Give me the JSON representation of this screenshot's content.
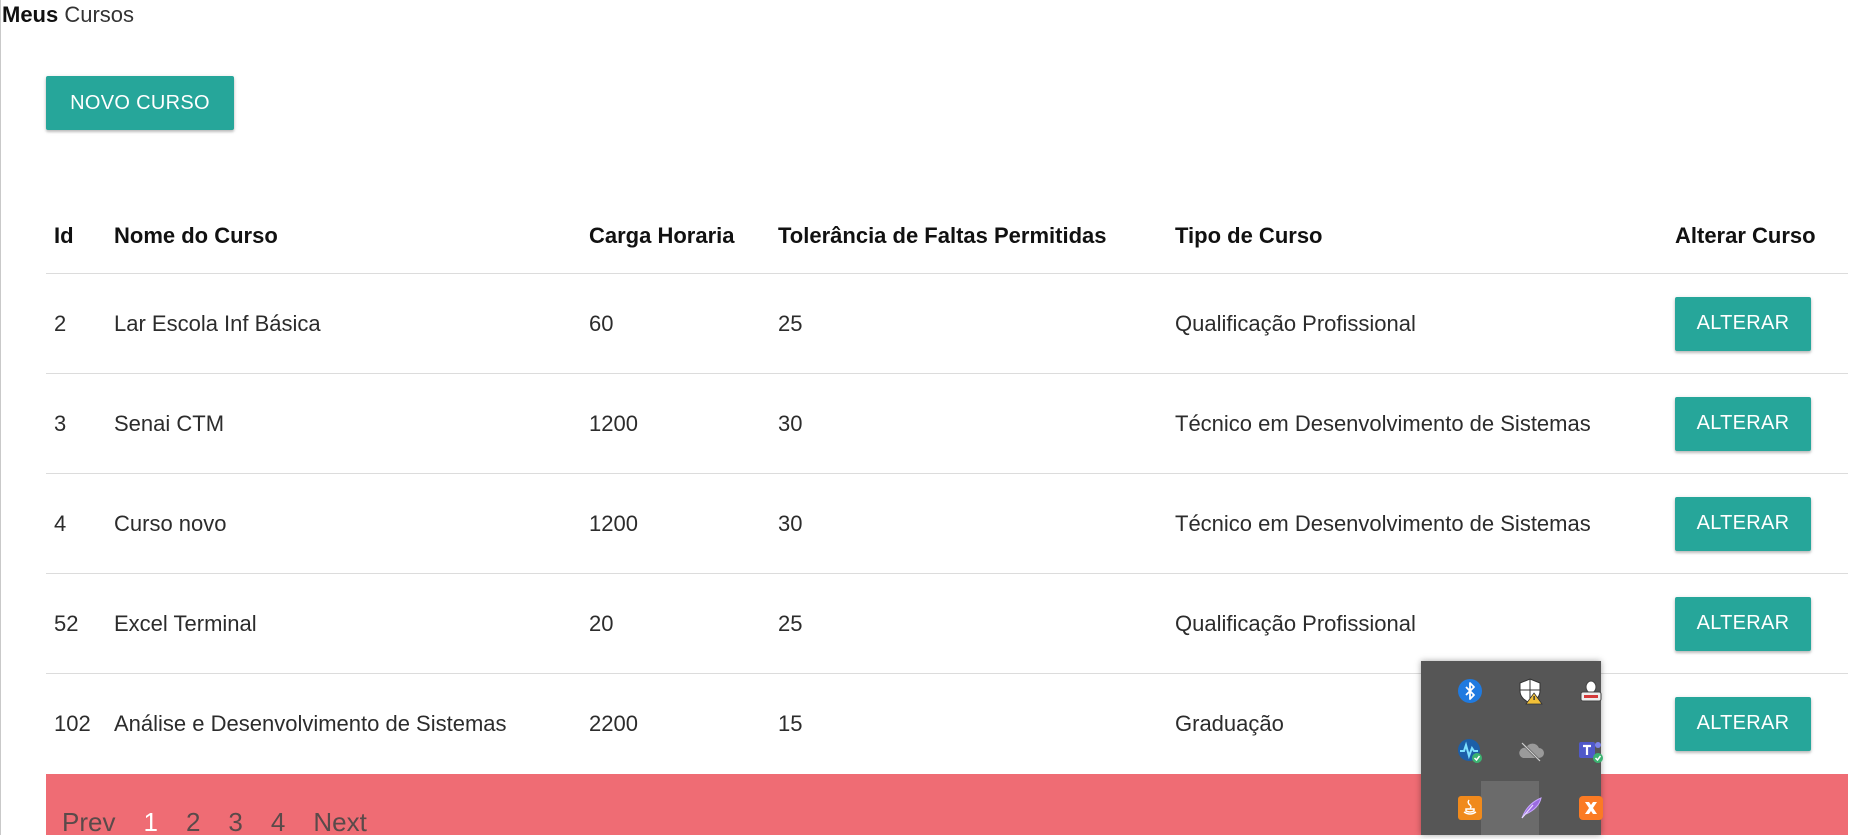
{
  "header": {
    "title_bold": "Meus",
    "title_rest": " Cursos"
  },
  "actions": {
    "new_course_label": "NOVO CURSO"
  },
  "table": {
    "columns": [
      "Id",
      "Nome do Curso",
      "Carga Horaria",
      "Tolerância de Faltas Permitidas",
      "Tipo de Curso",
      "Alterar Curso"
    ],
    "rows": [
      {
        "id": "2",
        "name": "Lar Escola Inf Básica",
        "hours": "60",
        "tolerance": "25",
        "type": "Qualificação Profissional",
        "action": "ALTERAR"
      },
      {
        "id": "3",
        "name": "Senai CTM",
        "hours": "1200",
        "tolerance": "30",
        "type": "Técnico em Desenvolvimento de Sistemas",
        "action": "ALTERAR"
      },
      {
        "id": "4",
        "name": "Curso novo",
        "hours": "1200",
        "tolerance": "30",
        "type": "Técnico em Desenvolvimento de Sistemas",
        "action": "ALTERAR"
      },
      {
        "id": "52",
        "name": "Excel Terminal",
        "hours": "20",
        "tolerance": "25",
        "type": "Qualificação Profissional",
        "action": "ALTERAR"
      },
      {
        "id": "102",
        "name": "Análise e Desenvolvimento de Sistemas",
        "hours": "2200",
        "tolerance": "15",
        "type": "Graduação",
        "action": "ALTERAR"
      }
    ]
  },
  "pagination": {
    "prev": "Prev",
    "pages": [
      "1",
      "2",
      "3",
      "4"
    ],
    "active_page": "1",
    "next": "Next"
  },
  "tray": {
    "icons": [
      "bluetooth-icon",
      "windows-security-icon",
      "pdf-printer-icon",
      "network-monitor-icon",
      "onedrive-icon",
      "teams-icon",
      "java-icon",
      "feather-app-icon",
      "xampp-icon"
    ]
  },
  "colors": {
    "accent": "#26a69a",
    "pagination_bg": "#ef6c74",
    "tray_bg": "#565656"
  }
}
